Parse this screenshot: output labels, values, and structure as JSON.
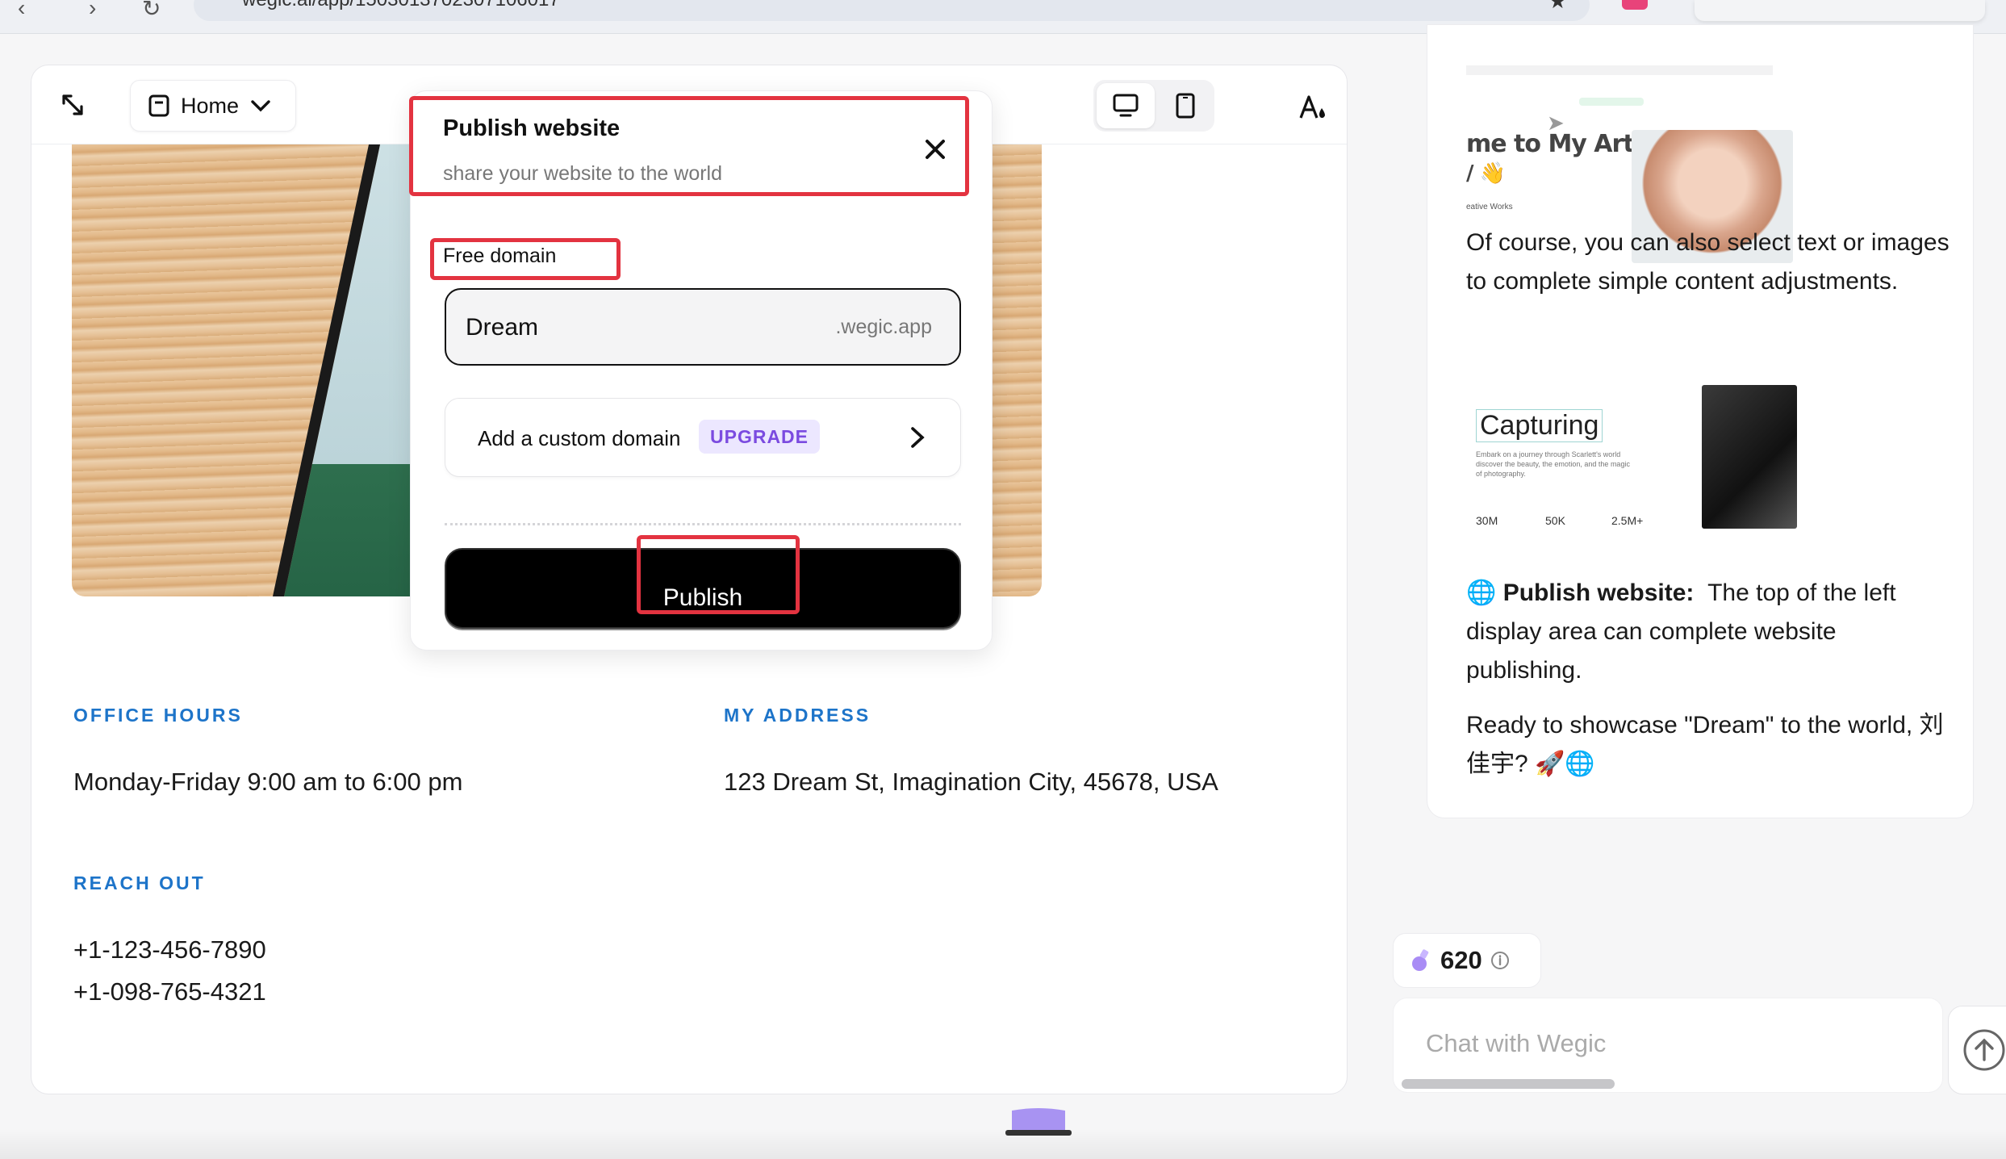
{
  "browser": {
    "url": "wegic.ai/app/1503013702307106017"
  },
  "toolbar": {
    "page_select_label": "Home"
  },
  "site": {
    "office_hours_title": "OFFICE HOURS",
    "office_hours_text": "Monday-Friday 9:00 am to 6:00 pm",
    "address_title": "MY ADDRESS",
    "address_text": "123 Dream St, Imagination City, 45678, USA",
    "reach_out_title": "REACH OUT",
    "phone_1": "+1-123-456-7890",
    "phone_2": "+1-098-765-4321"
  },
  "modal": {
    "title": "Publish website",
    "subtitle": "share your website to the world",
    "free_domain_label": "Free domain",
    "domain_value": "Dream",
    "domain_suffix": ".wegic.app",
    "custom_domain_label": "Add a custom domain",
    "upgrade_badge": "UPGRADE",
    "publish_label": "Publish"
  },
  "chat": {
    "thumb1_title": "me to My Art",
    "thumb1_line2": "/ 👋",
    "thumb1_sub": "eative Works",
    "message_1": "Of course, you can also select text or images to complete simple content adjustments.",
    "thumb2_heading": "Capturing",
    "thumb2_small": "Embark on a journey through Scarlett's world discover the beauty, the emotion, and the magic of photography.",
    "thumb2_stats": [
      "30M",
      "50K",
      "2.5M+"
    ],
    "publish_note_bold": "Publish website:",
    "publish_note_rest": "The top of the left display area can complete website publishing.",
    "message_3": "Ready to showcase \"Dream\" to the world, 刘佳宇? 🚀🌐",
    "credits": "620",
    "input_placeholder": "Chat with Wegic"
  },
  "colors": {
    "accent_blue": "#1d74c9",
    "highlight_red": "#e33340",
    "upgrade_purple": "#7b4be0",
    "upgrade_bg": "#ece7ff"
  }
}
